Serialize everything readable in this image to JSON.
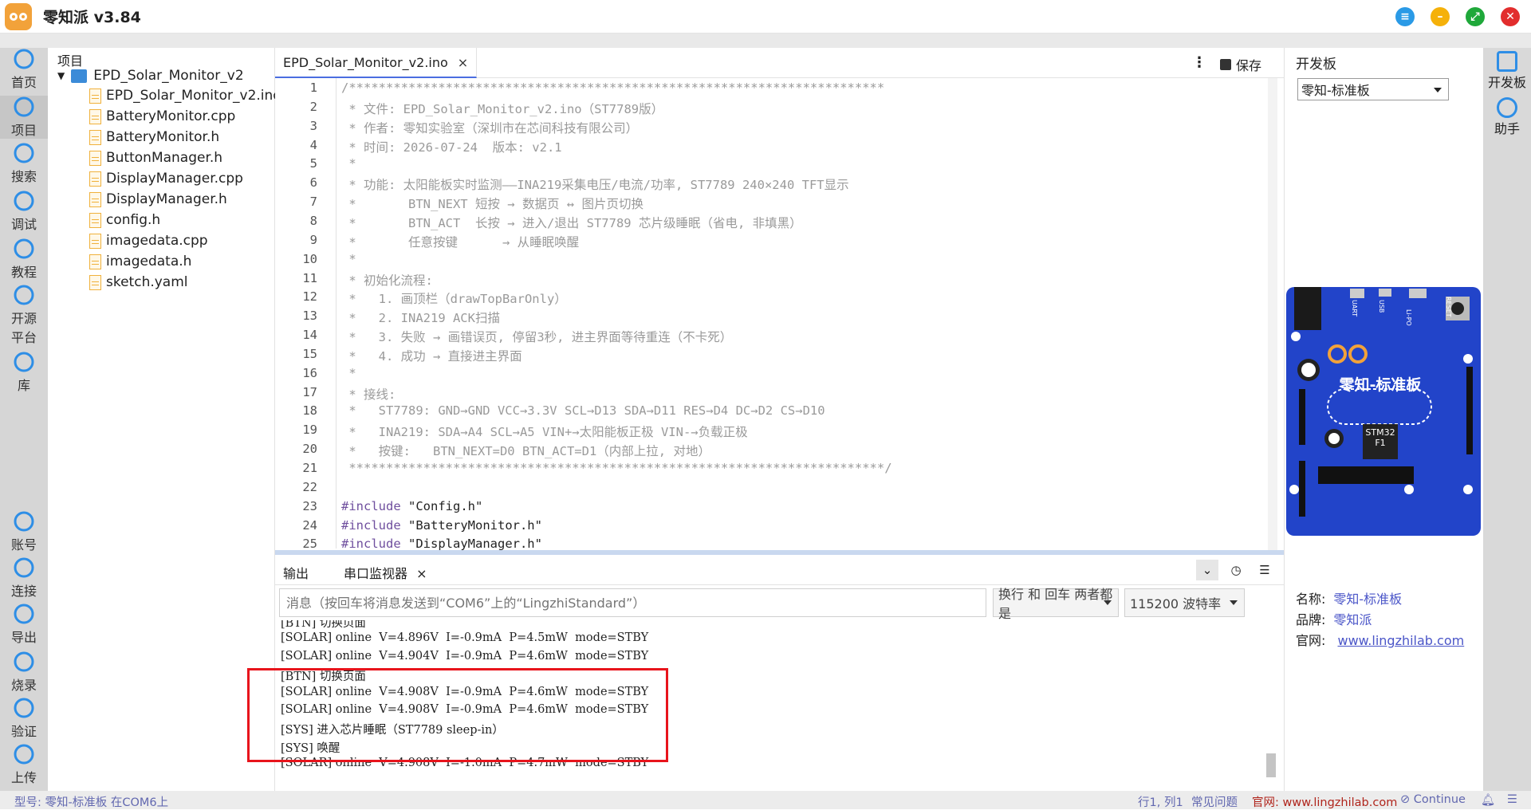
{
  "app": {
    "title": "零知派 v3.84"
  },
  "left_nav": [
    {
      "label": "首页",
      "icon": "home-icon"
    },
    {
      "label": "项目",
      "icon": "project-icon",
      "active": true
    },
    {
      "label": "搜索",
      "icon": "search-icon"
    },
    {
      "label": "调试",
      "icon": "debug-icon"
    },
    {
      "label": "教程",
      "icon": "tutorial-icon"
    },
    {
      "label": "开源\n平台",
      "icon": "open-source-icon"
    },
    {
      "label": "库",
      "icon": "library-icon"
    },
    {
      "label": "账号",
      "icon": "account-icon"
    },
    {
      "label": "连接",
      "icon": "connect-icon"
    },
    {
      "label": "导出",
      "icon": "export-icon"
    },
    {
      "label": "烧录",
      "icon": "flash-icon"
    },
    {
      "label": "验证",
      "icon": "verify-icon"
    },
    {
      "label": "上传",
      "icon": "upload-icon"
    }
  ],
  "project_tree": {
    "header": "项目",
    "root": "EPD_Solar_Monitor_v2",
    "files": [
      "EPD_Solar_Monitor_v2.ino",
      "BatteryMonitor.cpp",
      "BatteryMonitor.h",
      "ButtonManager.h",
      "DisplayManager.cpp",
      "DisplayManager.h",
      "config.h",
      "imagedata.cpp",
      "imagedata.h",
      "sketch.yaml"
    ]
  },
  "editor": {
    "tab_label": "EPD_Solar_Monitor_v2.ino",
    "tab_close": "×",
    "more": "⋮",
    "save_label": "保存",
    "lines": [
      {
        "n": "1",
        "t": "/************************************************************************"
      },
      {
        "n": "2",
        "t": " * 文件: EPD_Solar_Monitor_v2.ino（ST7789版）"
      },
      {
        "n": "3",
        "t": " * 作者: 零知实验室（深圳市在芯间科技有限公司）"
      },
      {
        "n": "4",
        "t": " * 时间: 2026-07-24  版本: v2.1"
      },
      {
        "n": "5",
        "t": " *"
      },
      {
        "n": "6",
        "t": " * 功能: 太阳能板实时监测——INA219采集电压/电流/功率, ST7789 240×240 TFT显示"
      },
      {
        "n": "7",
        "t": " *       BTN_NEXT 短按 → 数据页 ↔ 图片页切换"
      },
      {
        "n": "8",
        "t": " *       BTN_ACT  长按 → 进入/退出 ST7789 芯片级睡眠（省电, 非填黑）"
      },
      {
        "n": "9",
        "t": " *       任意按键      → 从睡眠唤醒"
      },
      {
        "n": "10",
        "t": " *"
      },
      {
        "n": "11",
        "t": " * 初始化流程:"
      },
      {
        "n": "12",
        "t": " *   1. 画顶栏（drawTopBarOnly）"
      },
      {
        "n": "13",
        "t": " *   2. INA219 ACK扫描"
      },
      {
        "n": "14",
        "t": " *   3. 失败 → 画错误页, 停留3秒, 进主界面等待重连（不卡死）"
      },
      {
        "n": "15",
        "t": " *   4. 成功 → 直接进主界面"
      },
      {
        "n": "16",
        "t": " *"
      },
      {
        "n": "17",
        "t": " * 接线:"
      },
      {
        "n": "18",
        "t": " *   ST7789: GND→GND VCC→3.3V SCL→D13 SDA→D11 RES→D4 DC→D2 CS→D10"
      },
      {
        "n": "19",
        "t": " *   INA219: SDA→A4 SCL→A5 VIN+→太阳能板正极 VIN-→负载正极"
      },
      {
        "n": "20",
        "t": " *   按键:   BTN_NEXT=D0 BTN_ACT=D1（内部上拉, 对地）"
      },
      {
        "n": "21",
        "t": " ************************************************************************/"
      },
      {
        "n": "22",
        "t": ""
      },
      {
        "n": "23",
        "t": "#include ",
        "s": "\"Config.h\""
      },
      {
        "n": "24",
        "t": "#include ",
        "s": "\"BatteryMonitor.h\""
      },
      {
        "n": "25",
        "t": "#include ",
        "s": "\"DisplayManager.h\""
      }
    ]
  },
  "bottom_panel": {
    "tab_output": "输出",
    "tab_serial": "串口监视器",
    "tab_close": "×",
    "message_placeholder": "消息（按回车将消息发送到“COM6”上的“LingzhiStandard”）",
    "line_ending": "换行 和 回车 两者都是",
    "baud": "115200 波特率",
    "serial_lines": [
      "[BTN] 切换页面",
      "[SOLAR] online  V=4.896V  I=-0.9mA  P=4.5mW  mode=STBY",
      "[SOLAR] online  V=4.904V  I=-0.9mA  P=4.6mW  mode=STBY",
      "[BTN] 切换页面",
      "[SOLAR] online  V=4.908V  I=-0.9mA  P=4.6mW  mode=STBY",
      "[SOLAR] online  V=4.908V  I=-0.9mA  P=4.6mW  mode=STBY",
      "[SYS] 进入芯片睡眠（ST7789 sleep-in）",
      "[SYS] 唤醒",
      "[SOLAR] online  V=4.908V  I=-1.0mA  P=4.7mW  mode=STBY"
    ]
  },
  "right_panel": {
    "header": "开发板",
    "board_select": "零知-标准板",
    "board_label": "零知-标准板",
    "chip_label": "STM32\nF1",
    "board_marks": [
      "UART",
      "USB",
      "Li-PO",
      "RESET"
    ],
    "name_label": "名称:",
    "name_value": "零知-标准板",
    "brand_label": "品牌:",
    "brand_value": "零知派",
    "site_label": "官网:",
    "site_value": "www.lingzhilab.com"
  },
  "right_nav": [
    {
      "label": "开发板",
      "icon": "board-icon"
    },
    {
      "label": "助手",
      "icon": "assistant-icon"
    }
  ],
  "status_bar": {
    "left": "型号: 零知-标准板  在COM6上",
    "position": "行1, 列1",
    "faq": "常见问题",
    "site": "官网: www.lingzhilab.com",
    "continue": "Continue"
  },
  "colors": {
    "accent": "#4a6ee0",
    "board": "#2244c9",
    "highlight": "#e8141c",
    "nav_icon": "#2e8ee6"
  }
}
